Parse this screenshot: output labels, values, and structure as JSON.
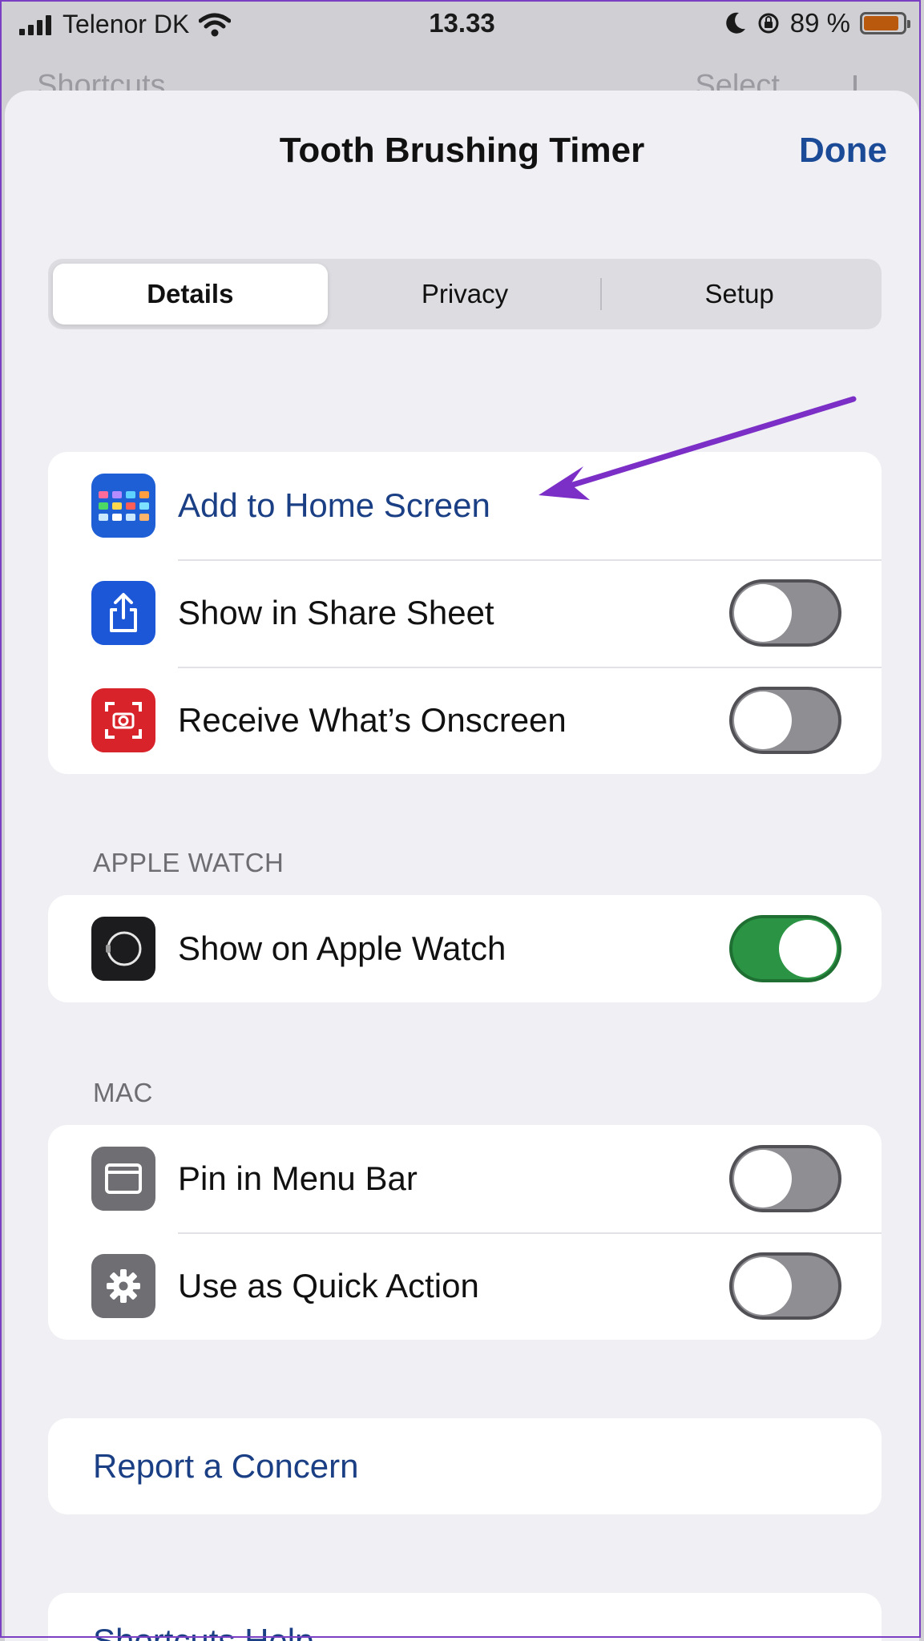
{
  "status_bar": {
    "carrier": "Telenor DK",
    "time": "13.33",
    "battery": "89 %",
    "battery_level": 0.89,
    "icons": [
      "signal-icon",
      "wifi-icon",
      "moon-icon",
      "rotation-lock-icon",
      "battery-icon"
    ]
  },
  "background_nav": {
    "back_label": "Shortcuts",
    "select_label": "Select"
  },
  "sheet": {
    "title": "Tooth Brushing Timer",
    "done_label": "Done"
  },
  "tabs": [
    {
      "label": "Details",
      "active": true
    },
    {
      "label": "Privacy",
      "active": false
    },
    {
      "label": "Setup",
      "active": false
    }
  ],
  "main_group": [
    {
      "label": "Add to Home Screen",
      "icon": "home-screen-icon",
      "color": "#1e5fd6"
    },
    {
      "label": "Show in Share Sheet",
      "icon": "share-icon",
      "color": "#1c57d8",
      "toggle": false
    },
    {
      "label": "Receive What’s Onscreen",
      "icon": "screenshot-camera-icon",
      "color": "#d9232b",
      "toggle": false
    }
  ],
  "apple_watch": {
    "header": "APPLE WATCH",
    "rows": [
      {
        "label": "Show on Apple Watch",
        "icon": "apple-watch-icon",
        "color": "#1c1c1e",
        "toggle": true
      }
    ]
  },
  "mac": {
    "header": "MAC",
    "rows": [
      {
        "label": "Pin in Menu Bar",
        "icon": "menu-bar-window-icon",
        "color": "#6e6e73",
        "toggle": false
      },
      {
        "label": "Use as Quick Action",
        "icon": "gear-icon",
        "color": "#6e6e73",
        "toggle": false
      }
    ]
  },
  "report": {
    "label": "Report a Concern"
  },
  "help": {
    "label": "Shortcuts Help"
  },
  "colors": {
    "accent": "#1b4a97",
    "toggle_on": "#2a9444",
    "toggle_off": "#8e8e93",
    "annotation_arrow": "#7b2fc6"
  }
}
